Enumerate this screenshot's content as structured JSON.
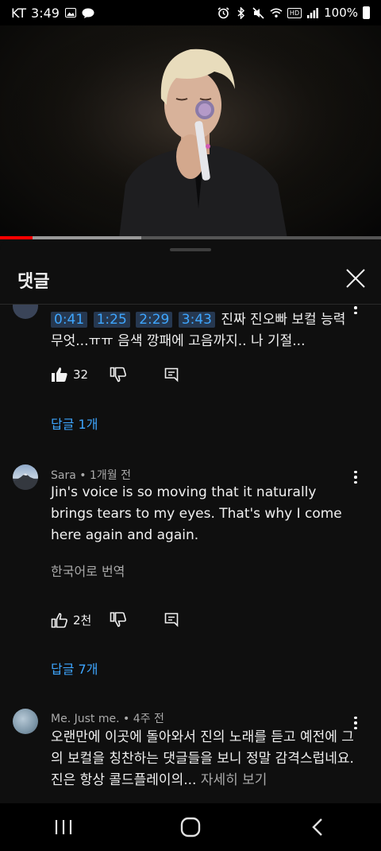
{
  "status_bar": {
    "carrier": "KT",
    "time": "3:49",
    "battery": "100%"
  },
  "video": {
    "progress": 0.085,
    "buffered": 0.37
  },
  "sheet": {
    "title": "댓글"
  },
  "comments": [
    {
      "timestamps": [
        "0:41",
        "1:25",
        "2:29",
        "3:43"
      ],
      "text": "진짜 진오빠 보컬 능력 무엇...ㅠㅠ 음색 깡패에 고음까지.. 나 기절...",
      "likes": "32",
      "replies": "답글 1개"
    },
    {
      "author": "Sara",
      "time": "1개월 전",
      "text": "Jin's voice is so moving that it naturally brings tears to my eyes. That's why I come here again and again.",
      "translate": "한국어로 번역",
      "likes": "2천",
      "replies": "답글 7개"
    },
    {
      "author": "Me. Just me.",
      "time": "4주 전",
      "text": "오랜만에 이곳에 돌아와서 진의 노래를 듣고 예전에 그의 보컬을 칭찬하는 댓글들을 보니 정말 감격스럽네요. 진은 항상 콜드플레이의...",
      "more": "자세히 보기"
    }
  ],
  "icons": {
    "status": [
      "gallery-icon",
      "talk-icon",
      "alarm-icon",
      "bluetooth-icon",
      "mute-icon",
      "wifi-icon",
      "hd-icon",
      "signal-icon",
      "battery-icon"
    ],
    "nav": [
      "recents-icon",
      "home-icon",
      "back-icon"
    ]
  },
  "colors": {
    "background": "#0f0f0f",
    "link": "#3ea6ff",
    "progress": "#ff0000",
    "timestamp_bg": "#263850"
  }
}
